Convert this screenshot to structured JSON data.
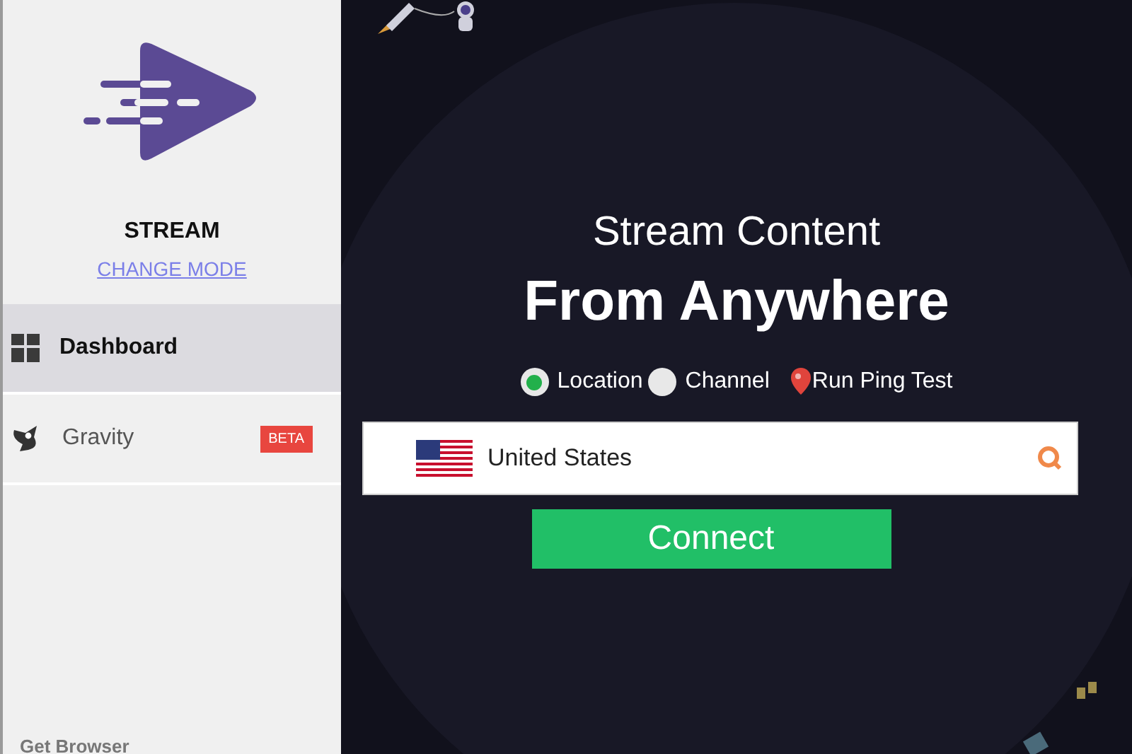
{
  "sidebar": {
    "app_name": "STREAM",
    "change_mode": "CHANGE MODE",
    "items": [
      {
        "label": "Dashboard",
        "selected": true
      },
      {
        "label": "Gravity",
        "selected": false,
        "badge": "BETA"
      }
    ],
    "footer": "Get Browser"
  },
  "main": {
    "subtitle": "Stream Content",
    "title": "From Anywhere",
    "options": [
      {
        "label": "Location",
        "selected": true
      },
      {
        "label": "Channel",
        "selected": false
      }
    ],
    "ping_button": "Run Ping Test",
    "country_field": {
      "value": "United States"
    },
    "connect_button": "Connect"
  }
}
